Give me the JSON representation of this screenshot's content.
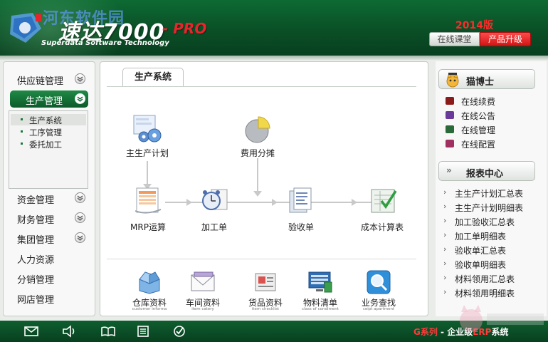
{
  "header": {
    "watermark": "河东软件园",
    "title": "速达7000",
    "title_suffix": "- PRO",
    "subtitle": "Superdata Software Technology",
    "year": "2014版",
    "btn_online": "在线课堂",
    "btn_upgrade": "产品升级"
  },
  "sidebar": {
    "items": [
      {
        "label": "供应链管理"
      },
      {
        "label": "生产管理"
      },
      {
        "label": "资金管理"
      },
      {
        "label": "财务管理"
      },
      {
        "label": "集团管理"
      },
      {
        "label": "人力资源"
      },
      {
        "label": "分销管理"
      },
      {
        "label": "网店管理"
      }
    ],
    "sub_items": [
      {
        "label": "生产系统"
      },
      {
        "label": "工序管理"
      },
      {
        "label": "委托加工"
      }
    ]
  },
  "main": {
    "tab": "生产系统",
    "flow": {
      "plan": "主生产计划",
      "cost_share": "费用分摊",
      "mrp": "MRP运算",
      "process": "加工单",
      "check": "验收单",
      "cost_calc": "成本计算表"
    },
    "bottom": [
      {
        "label": "仓库资料",
        "en": "customer informa"
      },
      {
        "label": "车间资料",
        "en": "item catery"
      },
      {
        "label": "货品资料",
        "en": "item checklist"
      },
      {
        "label": "物料清单",
        "en": "class of condiment"
      },
      {
        "label": "业务查找",
        "en": "ceipt apartment"
      }
    ]
  },
  "right": {
    "assistant_title": "猫博士",
    "assistant_links": [
      {
        "label": "在线续费",
        "color": "#8b1a1a"
      },
      {
        "label": "在线公告",
        "color": "#6a3a9a"
      },
      {
        "label": "在线管理",
        "color": "#2a6a3a"
      },
      {
        "label": "在线配置",
        "color": "#a03060"
      }
    ],
    "report_title": "报表中心",
    "reports": [
      {
        "label": "主生产计划汇总表"
      },
      {
        "label": "主生产计划明细表"
      },
      {
        "label": "加工验收汇总表"
      },
      {
        "label": "加工单明细表"
      },
      {
        "label": "验收单汇总表"
      },
      {
        "label": "验收单明细表"
      },
      {
        "label": "材料领用汇总表"
      },
      {
        "label": "材料领用明细表"
      }
    ]
  },
  "footer": {
    "icons": [
      "mail-icon",
      "speaker-icon",
      "book-icon",
      "list-icon",
      "check-circle-icon"
    ],
    "text_left": "G系列",
    "text_mid": " - 企业级",
    "text_erp": "ERP",
    "text_right": "系统"
  },
  "colors": {
    "brand_green": "#0a4f26",
    "accent_red": "#e8242c"
  }
}
